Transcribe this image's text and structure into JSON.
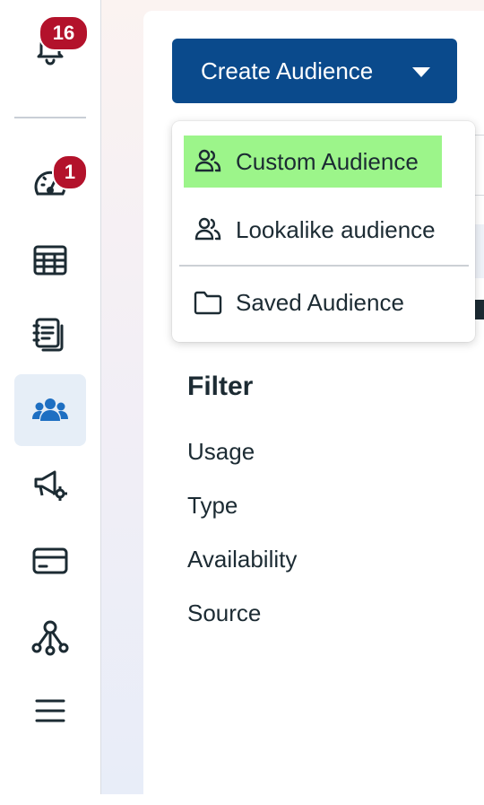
{
  "rail": {
    "notifications_badge": "16",
    "performance_badge": "1"
  },
  "create_button": {
    "label": "Create Audience"
  },
  "dropdown": {
    "items": [
      {
        "label": "Custom Audience",
        "icon": "people-icon"
      },
      {
        "label": "Lookalike audience",
        "icon": "people-icon"
      },
      {
        "label": "Saved Audience",
        "icon": "folder-icon"
      }
    ]
  },
  "filter": {
    "title": "Filter",
    "items": [
      "Usage",
      "Type",
      "Availability",
      "Source"
    ]
  },
  "colors": {
    "primary_button": "#0a4a8c",
    "highlight": "#9cf58a",
    "badge": "#b3122b",
    "active_rail": "#e6eef7"
  }
}
